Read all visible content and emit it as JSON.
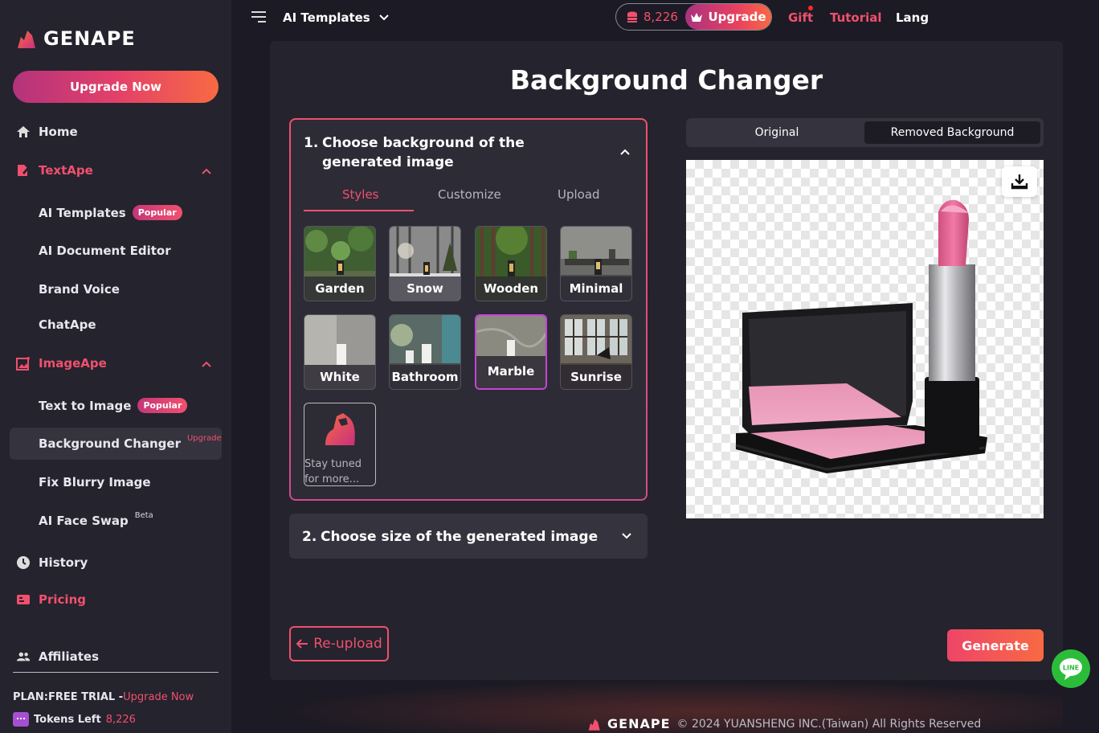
{
  "brand": {
    "name": "GENAPE"
  },
  "sidebar": {
    "upgrade_now": "Upgrade Now",
    "home": "Home",
    "textape": {
      "label": "TextApe",
      "items": [
        {
          "label": "AI Templates",
          "badge": "Popular"
        },
        {
          "label": "AI Document Editor"
        },
        {
          "label": "Brand Voice"
        },
        {
          "label": "ChatApe"
        }
      ]
    },
    "imageape": {
      "label": "ImageApe",
      "items": [
        {
          "label": "Text to Image",
          "badge": "Popular"
        },
        {
          "label": "Background Changer",
          "tag": "Upgrade"
        },
        {
          "label": "Fix Blurry Image"
        },
        {
          "label": "AI Face Swap",
          "tag": "Beta"
        }
      ]
    },
    "history": "History",
    "pricing": "Pricing",
    "affiliates": "Affiliates",
    "plan_label": "PLAN:FREE TRIAL -",
    "plan_upgrade": "Upgrade Now",
    "tokens_label": "Tokens Left",
    "tokens_value": "8,226"
  },
  "topbar": {
    "title": "AI Templates",
    "credits": "8,226",
    "upgrade": "Upgrade",
    "gift": "Gift",
    "tutorial": "Tutorial",
    "lang": "Lang"
  },
  "main": {
    "title": "Background Changer",
    "step1": {
      "number": "1.",
      "title": "Choose background of the generated image",
      "tabs": [
        "Styles",
        "Customize",
        "Upload"
      ],
      "styles": [
        "Garden",
        "Snow",
        "Wooden",
        "Minimal",
        "White",
        "Bathroom",
        "Marble",
        "Sunrise"
      ],
      "selected": "Marble",
      "stay_tuned": "Stay tuned for more..."
    },
    "step2": {
      "number": "2.",
      "title": "Choose size of the generated image"
    },
    "preview_tabs": {
      "original": "Original",
      "removed": "Removed Background"
    },
    "reupload": "Re-upload",
    "generate": "Generate"
  },
  "footer": {
    "brand": "GENAPE",
    "copyright": "© 2024 YUANSHENG INC.(Taiwan) All Rights Reserved"
  },
  "colors": {
    "accent": "#f0506e",
    "panel": "#25232d",
    "background": "#1c1a24",
    "selected_border": "#c842d8"
  }
}
